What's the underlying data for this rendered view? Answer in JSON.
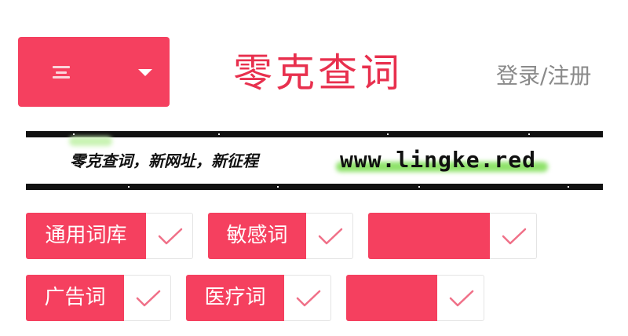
{
  "header": {
    "menu_icon": "hamburger-icon",
    "dropdown_icon": "caret-down-icon",
    "logo_text": "零克查词",
    "login_label": "登录/注册"
  },
  "banner": {
    "slogan": "零克查词，新网址，新征程",
    "url": "www.lingke.red"
  },
  "tags": [
    {
      "label": "通用词库",
      "checked": true
    },
    {
      "label": "敏感词",
      "checked": true
    },
    {
      "label": "",
      "checked": true
    },
    {
      "label": "广告词",
      "checked": true
    },
    {
      "label": "医疗词",
      "checked": true
    },
    {
      "label": "",
      "checked": true
    }
  ],
  "colors": {
    "accent": "#f5405f",
    "logo": "#e8304e",
    "check": "#f07088",
    "muted_text": "#8a8a8a"
  }
}
